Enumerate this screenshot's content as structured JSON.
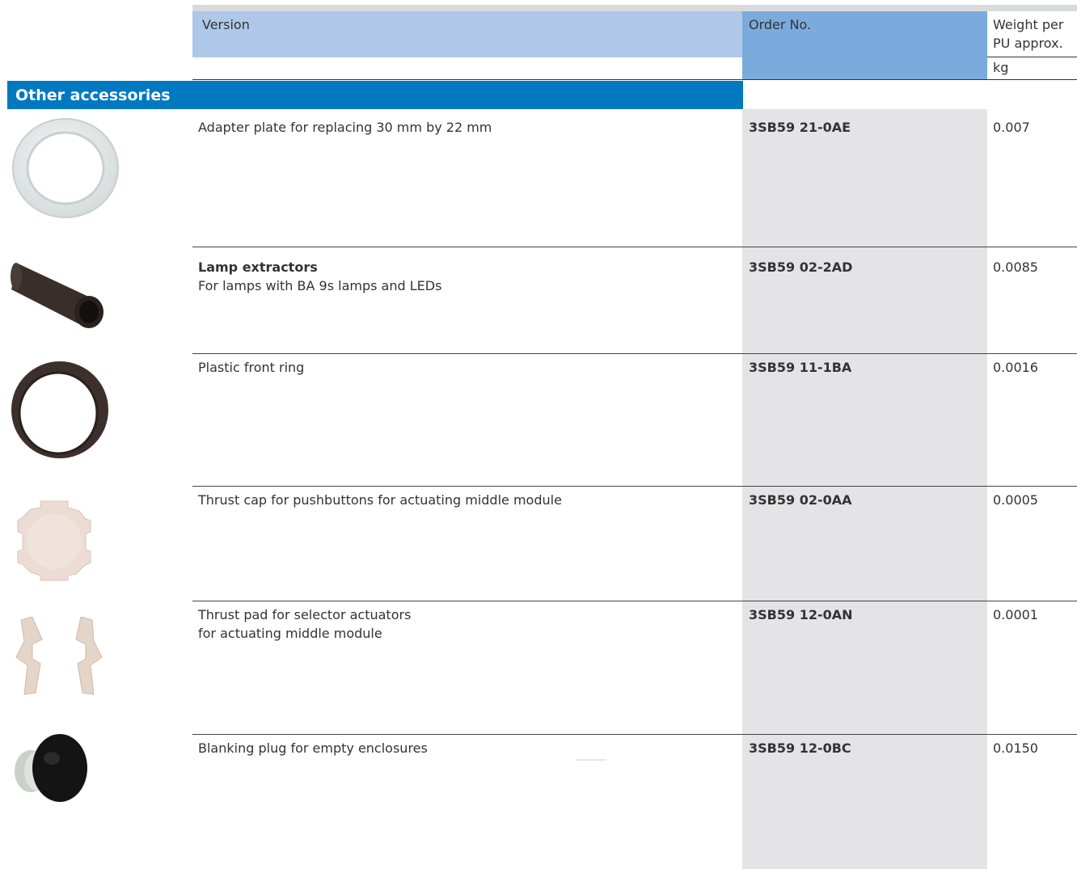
{
  "header": {
    "version_label": "Version",
    "order_label": "Order No.",
    "weight_label_line1": "Weight per",
    "weight_label_line2": "PU approx.",
    "weight_unit": "kg"
  },
  "section": {
    "title": "Other accessories"
  },
  "rows": [
    {
      "name_bold": "",
      "description_line1": "Adapter plate for replacing 30 mm by 22 mm",
      "description_line2": "",
      "order_no": "3SB59 21-0AE",
      "weight": "0.007",
      "icon": "adapter-plate-icon"
    },
    {
      "name_bold": "Lamp extractors",
      "description_line1": "For lamps with BA 9s lamps and LEDs",
      "description_line2": "",
      "order_no": "3SB59 02-2AD",
      "weight": "0.0085",
      "icon": "lamp-extractor-icon"
    },
    {
      "name_bold": "",
      "description_line1": "Plastic front ring",
      "description_line2": "",
      "order_no": "3SB59 11-1BA",
      "weight": "0.0016",
      "icon": "front-ring-icon"
    },
    {
      "name_bold": "",
      "description_line1": "Thrust cap for pushbuttons for actuating middle module",
      "description_line2": "",
      "order_no": "3SB59 02-0AA",
      "weight": "0.0005",
      "icon": "thrust-cap-icon"
    },
    {
      "name_bold": "",
      "description_line1": "Thrust pad for selector actuators",
      "description_line2": "for actuating middle module",
      "order_no": "3SB59 12-0AN",
      "weight": "0.0001",
      "icon": "thrust-pad-icon"
    },
    {
      "name_bold": "",
      "description_line1": "Blanking plug for empty enclosures",
      "description_line2": "",
      "order_no": "3SB59 12-0BC",
      "weight": "0.0150",
      "icon": "blanking-plug-icon"
    }
  ],
  "colors": {
    "section_bar": "#0079c1",
    "header_version": "#afc8e9",
    "header_order": "#7baadc",
    "order_column": "#e4e4e6"
  }
}
